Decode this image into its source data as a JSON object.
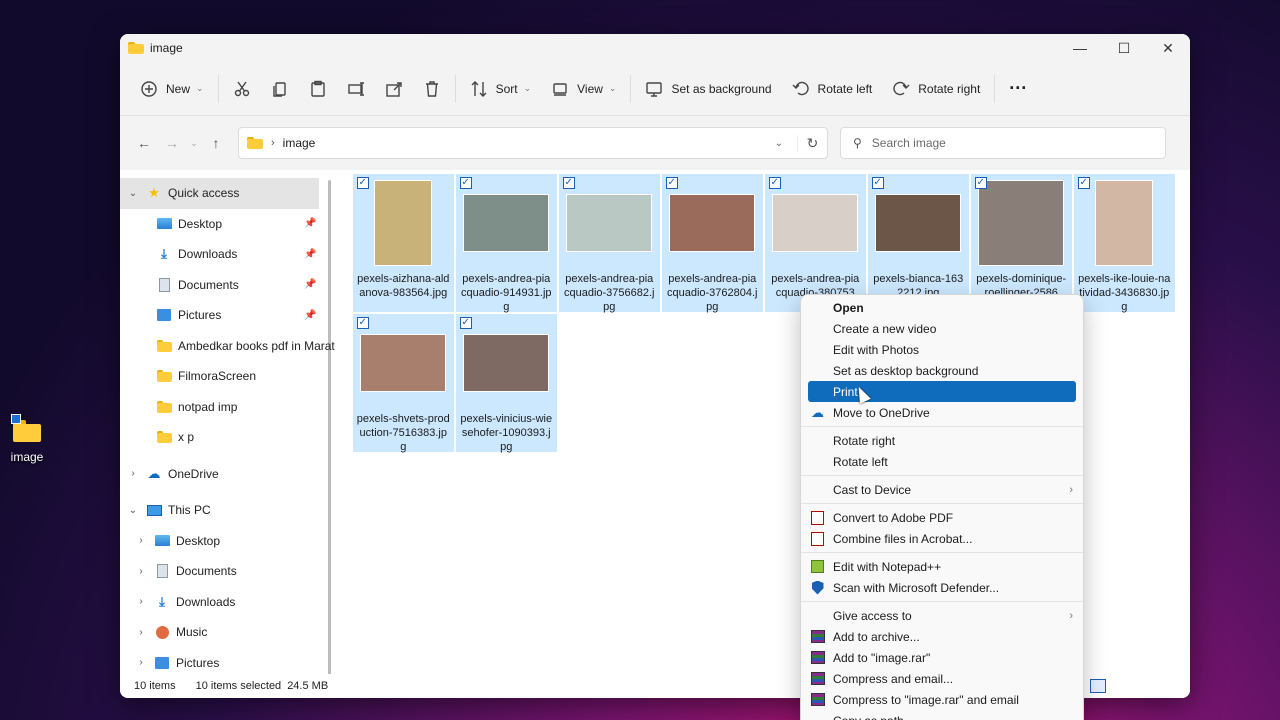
{
  "desktop": {
    "icon_label": "image"
  },
  "window": {
    "title": "image",
    "controls": {
      "minimize": "—",
      "maximize": "☐",
      "close": "✕"
    }
  },
  "toolbar": {
    "new_label": "New",
    "sort_label": "Sort",
    "view_label": "View",
    "set_background_label": "Set as background",
    "rotate_left_label": "Rotate left",
    "rotate_right_label": "Rotate right",
    "more_label": "···"
  },
  "address": {
    "segment": "image",
    "search_placeholder": "Search image"
  },
  "sidebar": {
    "items": [
      {
        "label": "Quick access",
        "icon": "star-icon"
      },
      {
        "label": "Desktop",
        "icon": "desktop-icon",
        "pinned": true
      },
      {
        "label": "Downloads",
        "icon": "download-icon",
        "pinned": true
      },
      {
        "label": "Documents",
        "icon": "documents-icon",
        "pinned": true
      },
      {
        "label": "Pictures",
        "icon": "pictures-icon",
        "pinned": true
      },
      {
        "label": "Ambedkar books pdf in Marat",
        "icon": "folder-icon"
      },
      {
        "label": "FilmoraScreen",
        "icon": "folder-icon"
      },
      {
        "label": "notpad imp",
        "icon": "folder-icon"
      },
      {
        "label": "x p",
        "icon": "folder-icon"
      },
      {
        "label": "OneDrive",
        "icon": "cloud-icon"
      },
      {
        "label": "This PC",
        "icon": "pc-icon"
      },
      {
        "label": "Desktop",
        "icon": "desktop-icon"
      },
      {
        "label": "Documents",
        "icon": "documents-icon"
      },
      {
        "label": "Downloads",
        "icon": "download-icon"
      },
      {
        "label": "Music",
        "icon": "music-icon"
      },
      {
        "label": "Pictures",
        "icon": "pictures-icon"
      }
    ]
  },
  "files": [
    {
      "name": "pexels-aizhana-aldanova-983564.jpg",
      "thumb": "#c9b27a"
    },
    {
      "name": "pexels-andrea-piacquadio-914931.jpg",
      "thumb": "#7d8f88"
    },
    {
      "name": "pexels-andrea-piacquadio-3756682.jpg",
      "thumb": "#b9c8c2"
    },
    {
      "name": "pexels-andrea-piacquadio-3762804.jpg",
      "thumb": "#9a6a5a"
    },
    {
      "name": "pexels-andrea-piacquadio-380753",
      "thumb": "#d8cfc9"
    },
    {
      "name": "pexels-bianca-1632212.jpg",
      "thumb": "#6b5648"
    },
    {
      "name": "pexels-dominique-roellinger-2586",
      "thumb": "#8a7f78"
    },
    {
      "name": "pexels-ike-louie-natividad-3436830.jpg",
      "thumb": "#d2b8a4"
    },
    {
      "name": "pexels-shvets-production-7516383.jpg",
      "thumb": "#a87e6c"
    },
    {
      "name": "pexels-vinicius-wiesehofer-1090393.jpg",
      "thumb": "#7f6a63"
    }
  ],
  "status": {
    "count": "10 items",
    "selected": "10 items selected",
    "size": "24.5 MB"
  },
  "context_menu": {
    "items": [
      {
        "label": "Open",
        "bold": true
      },
      {
        "label": "Create a new video"
      },
      {
        "label": "Edit with Photos"
      },
      {
        "label": "Set as desktop background"
      },
      {
        "label": "Print",
        "highlighted": true
      },
      {
        "label": "Move to OneDrive",
        "icon": "onedrive-icon"
      },
      {
        "sep": true
      },
      {
        "label": "Rotate right"
      },
      {
        "label": "Rotate left"
      },
      {
        "sep": true
      },
      {
        "label": "Cast to Device",
        "submenu": true
      },
      {
        "sep": true
      },
      {
        "label": "Convert to Adobe PDF",
        "icon": "pdf-icon"
      },
      {
        "label": "Combine files in Acrobat...",
        "icon": "acrobat-icon"
      },
      {
        "sep": true
      },
      {
        "label": "Edit with Notepad++",
        "icon": "notepadpp-icon"
      },
      {
        "label": "Scan with Microsoft Defender...",
        "icon": "defender-icon"
      },
      {
        "sep": true
      },
      {
        "label": "Give access to",
        "submenu": true
      },
      {
        "label": "Add to archive...",
        "icon": "winrar-icon"
      },
      {
        "label": "Add to \"image.rar\"",
        "icon": "winrar-icon"
      },
      {
        "label": "Compress and email...",
        "icon": "winrar-icon"
      },
      {
        "label": "Compress to \"image.rar\" and email",
        "icon": "winrar-icon"
      },
      {
        "label": "Copy as path"
      }
    ]
  }
}
